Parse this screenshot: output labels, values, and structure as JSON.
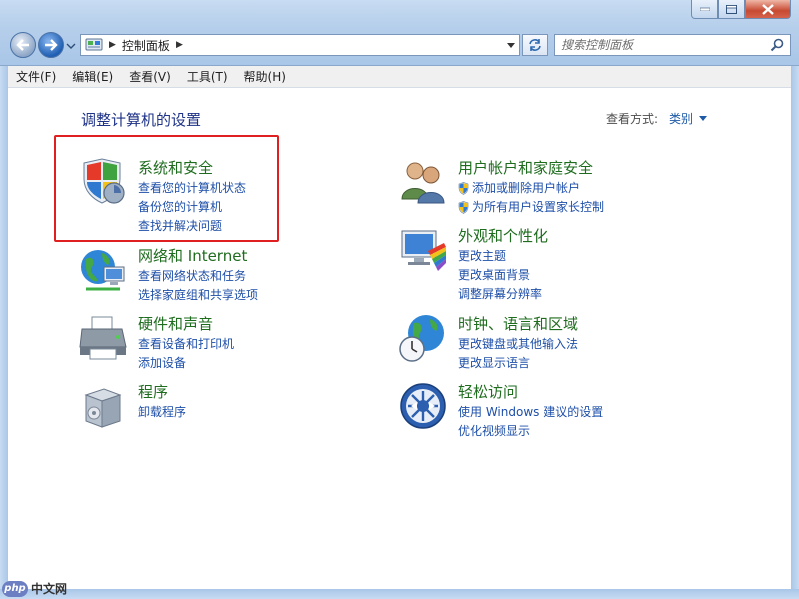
{
  "window": {
    "controls": {
      "minimize": "minimize",
      "maximize": "maximize",
      "close": "close"
    }
  },
  "address": {
    "path": "控制面板",
    "separator": "▶"
  },
  "search": {
    "placeholder": "搜索控制面板"
  },
  "menu": {
    "items": [
      "文件(F)",
      "编辑(E)",
      "查看(V)",
      "工具(T)",
      "帮助(H)"
    ]
  },
  "page": {
    "title": "调整计算机的设置",
    "view_label": "查看方式:",
    "view_value": "类别"
  },
  "categories": [
    {
      "title": "系统和安全",
      "links": [
        "查看您的计算机状态",
        "备份您的计算机",
        "查找并解决问题"
      ],
      "icon": "security-shield-icon"
    },
    {
      "title": "网络和 Internet",
      "links": [
        "查看网络状态和任务",
        "选择家庭组和共享选项"
      ],
      "icon": "network-globe-icon"
    },
    {
      "title": "硬件和声音",
      "links": [
        "查看设备和打印机",
        "添加设备"
      ],
      "icon": "printer-icon"
    },
    {
      "title": "程序",
      "links": [
        "卸载程序"
      ],
      "icon": "programs-box-icon"
    },
    {
      "title": "用户帐户和家庭安全",
      "links": [
        "添加或删除用户帐户",
        "为所有用户设置家长控制"
      ],
      "icon": "users-icon"
    },
    {
      "title": "外观和个性化",
      "links": [
        "更改主题",
        "更改桌面背景",
        "调整屏幕分辨率"
      ],
      "icon": "display-palette-icon"
    },
    {
      "title": "时钟、语言和区域",
      "links": [
        "更改键盘或其他输入法",
        "更改显示语言"
      ],
      "icon": "globe-clock-icon"
    },
    {
      "title": "轻松访问",
      "links": [
        "使用 Windows 建议的设置",
        "优化视频显示"
      ],
      "icon": "ease-of-access-icon"
    }
  ],
  "watermark": {
    "logo": "php",
    "text": "中文网"
  },
  "colors": {
    "title_blue": "#1e3287",
    "category_green": "#1e6c1e",
    "link_blue": "#1e4fa8",
    "highlight_red": "#e02020"
  }
}
